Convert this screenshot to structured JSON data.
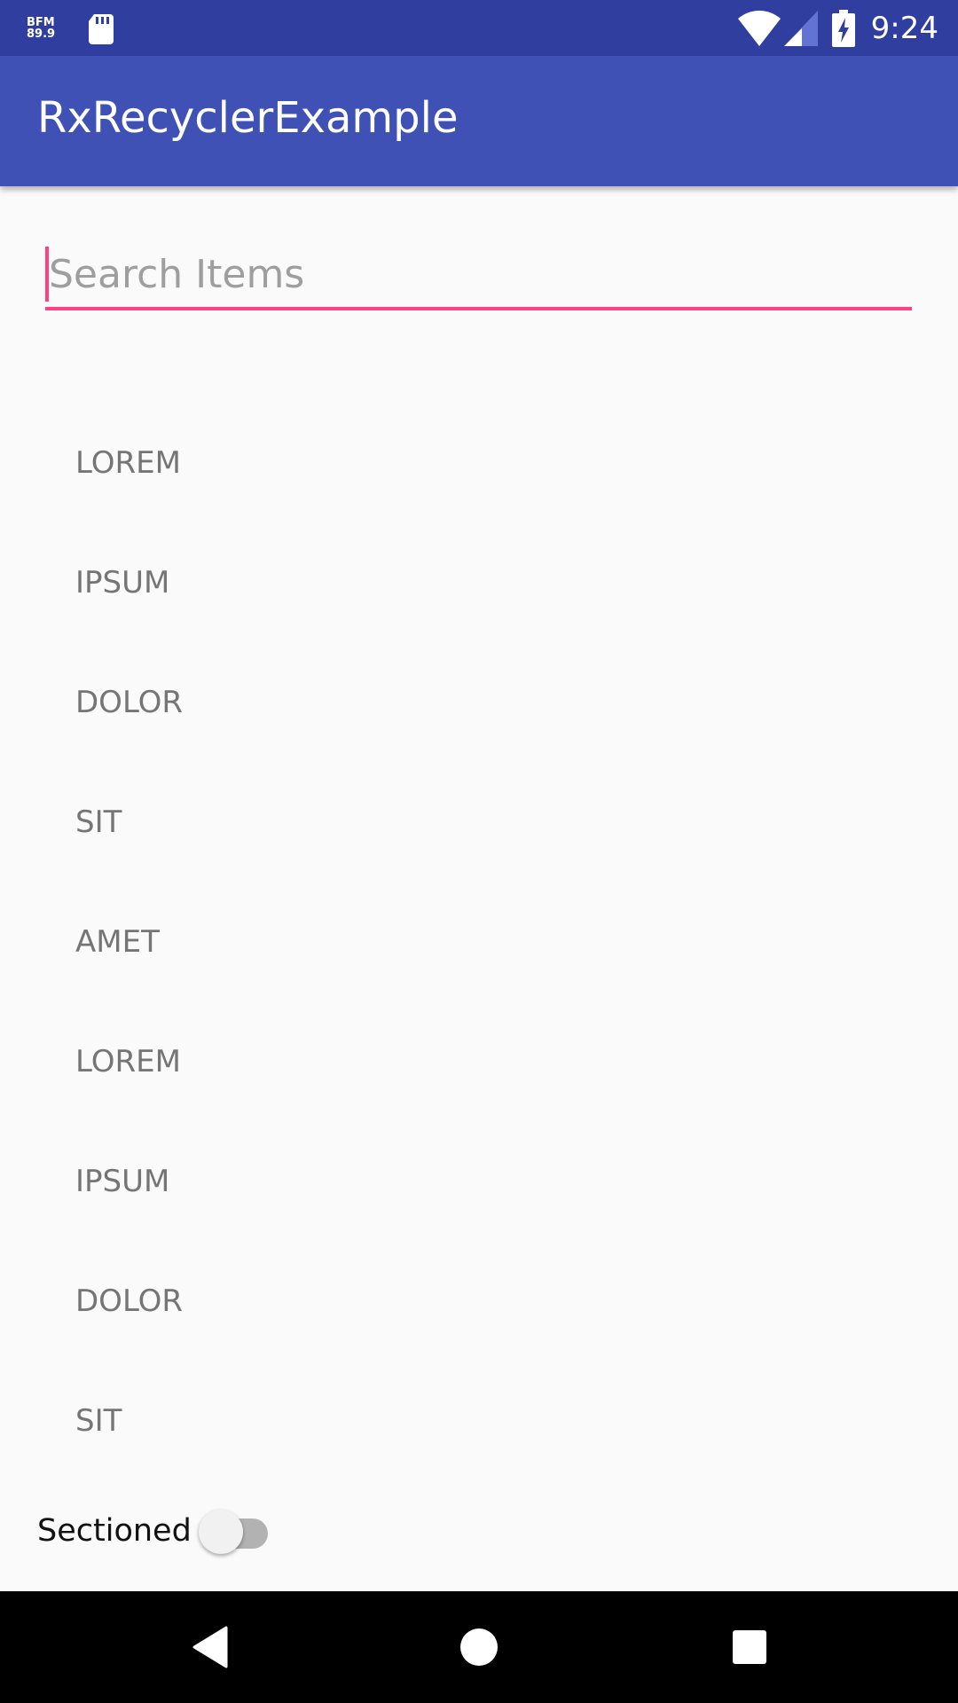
{
  "status_bar": {
    "radio_line1": "BFM",
    "radio_line2": "89.9",
    "time": "9:24",
    "icons": [
      "radio-badge-icon",
      "sd-card-icon",
      "wifi-icon",
      "cell-signal-icon",
      "battery-charging-icon"
    ],
    "background_color": "#303f9f"
  },
  "app_bar": {
    "title": "RxRecyclerExample",
    "background_color": "#3f51b5"
  },
  "search": {
    "placeholder": "Search Items",
    "value": "",
    "accent_color": "#ff4081"
  },
  "list": {
    "items": [
      {
        "label": "LOREM"
      },
      {
        "label": "IPSUM"
      },
      {
        "label": "DOLOR"
      },
      {
        "label": "SIT"
      },
      {
        "label": "AMET"
      },
      {
        "label": "LOREM"
      },
      {
        "label": "IPSUM"
      },
      {
        "label": "DOLOR"
      },
      {
        "label": "SIT"
      }
    ]
  },
  "sectioned_toggle": {
    "label": "Sectioned",
    "checked": false
  },
  "nav_bar": {
    "buttons": [
      "back-icon",
      "home-icon",
      "recents-icon"
    ]
  }
}
